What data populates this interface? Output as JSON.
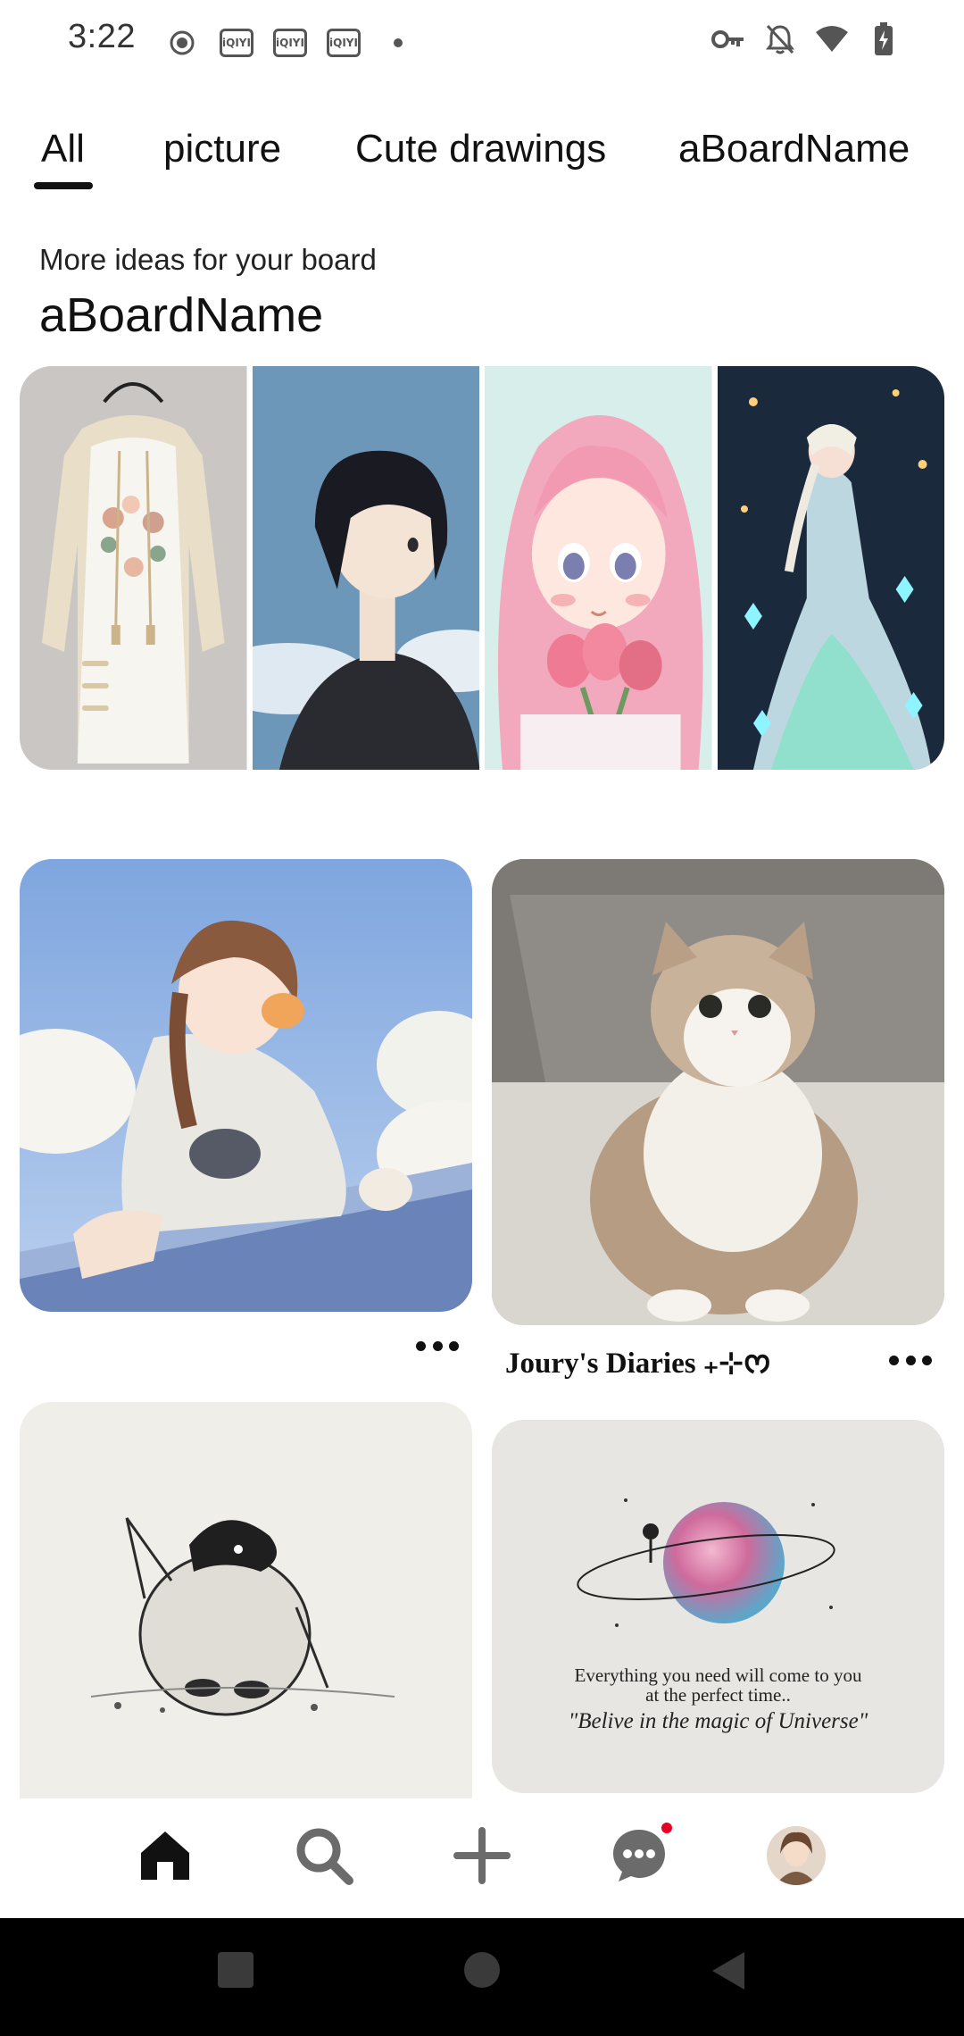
{
  "status_bar": {
    "time": "3:22",
    "left_icons": [
      "record-icon",
      "iqiyi-icon",
      "iqiyi-icon",
      "iqiyi-icon",
      "dot-icon"
    ],
    "iqiyi_text": "iQIYI",
    "right_icons": [
      "key-icon",
      "bell-off-icon",
      "wifi-icon",
      "battery-charging-icon"
    ]
  },
  "tabs": [
    {
      "label": "All",
      "selected": true
    },
    {
      "label": "picture",
      "selected": false
    },
    {
      "label": "Cute drawings",
      "selected": false
    },
    {
      "label": "aBoardName",
      "selected": false
    }
  ],
  "board_suggestion": {
    "subtitle": "More ideas for your board",
    "title": "aBoardName",
    "images": [
      "hoodie-dress-image",
      "short-hair-girl-image",
      "pink-hair-girl-image",
      "ice-princess-image"
    ]
  },
  "pins": [
    {
      "image": "girl-with-cats-illustration",
      "caption": ""
    },
    {
      "image": "fluffy-kitten-photo",
      "caption": "Joury's Diaries ₊⊹ᰔ"
    },
    {
      "image": "penguin-sketch-image",
      "caption": ""
    },
    {
      "image": "watercolor-planet-card",
      "caption": "",
      "card_text_line1": "Everything you need will come to you",
      "card_text_line2": "at the perfect time..",
      "card_text_quote": "\"Belive in the magic of Universe\""
    }
  ],
  "bottom_nav": {
    "items": [
      "home-icon",
      "search-icon",
      "create-icon",
      "messages-icon",
      "profile-avatar"
    ],
    "active": "home-icon",
    "accent_color": "#e60023"
  },
  "system_nav": [
    "recents-button",
    "home-button",
    "back-button"
  ]
}
